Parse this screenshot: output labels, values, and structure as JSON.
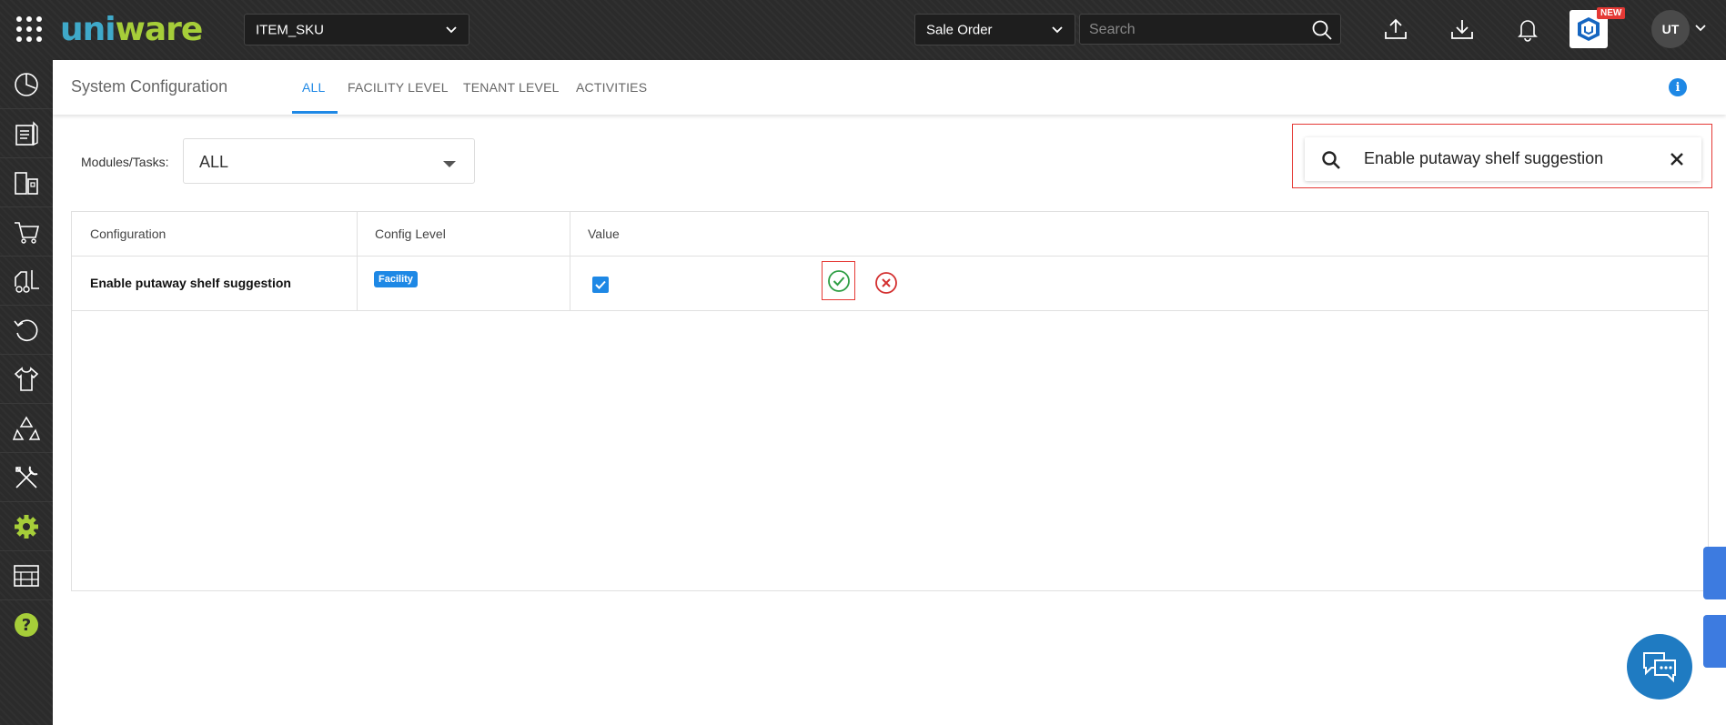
{
  "topbar": {
    "logo": {
      "part1": "uni",
      "part2": "ware"
    },
    "item_select": "ITEM_SKU",
    "entity_select": "Sale Order",
    "search_placeholder": "Search",
    "new_badge": "NEW",
    "avatar_initials": "UT"
  },
  "sidebar": {
    "items": [
      "dashboard-icon",
      "orders-icon",
      "inventory-icon",
      "cart-icon",
      "forklift-icon",
      "returns-icon",
      "apparel-icon",
      "recycle-icon",
      "tools-icon",
      "settings-icon",
      "warehouse-icon",
      "help-icon"
    ],
    "active_color": "#a6ce39"
  },
  "header": {
    "title": "System Configuration",
    "tabs": [
      {
        "label": "ALL",
        "active": true
      },
      {
        "label": "FACILITY LEVEL",
        "active": false
      },
      {
        "label": "TENANT LEVEL",
        "active": false
      },
      {
        "label": "ACTIVITIES",
        "active": false
      }
    ]
  },
  "filters": {
    "modules_label": "Modules/Tasks:",
    "modules_value": "ALL",
    "search_value": "Enable putaway shelf suggestion"
  },
  "table": {
    "columns": [
      "Configuration",
      "Config Level",
      "Value"
    ],
    "rows": [
      {
        "configuration": "Enable putaway shelf suggestion",
        "level": "Facility",
        "checked": true
      }
    ]
  },
  "colors": {
    "accent": "#1e88e5",
    "highlight": "#e53935",
    "confirm": "#2e9e44",
    "cancel": "#d32f2f"
  }
}
